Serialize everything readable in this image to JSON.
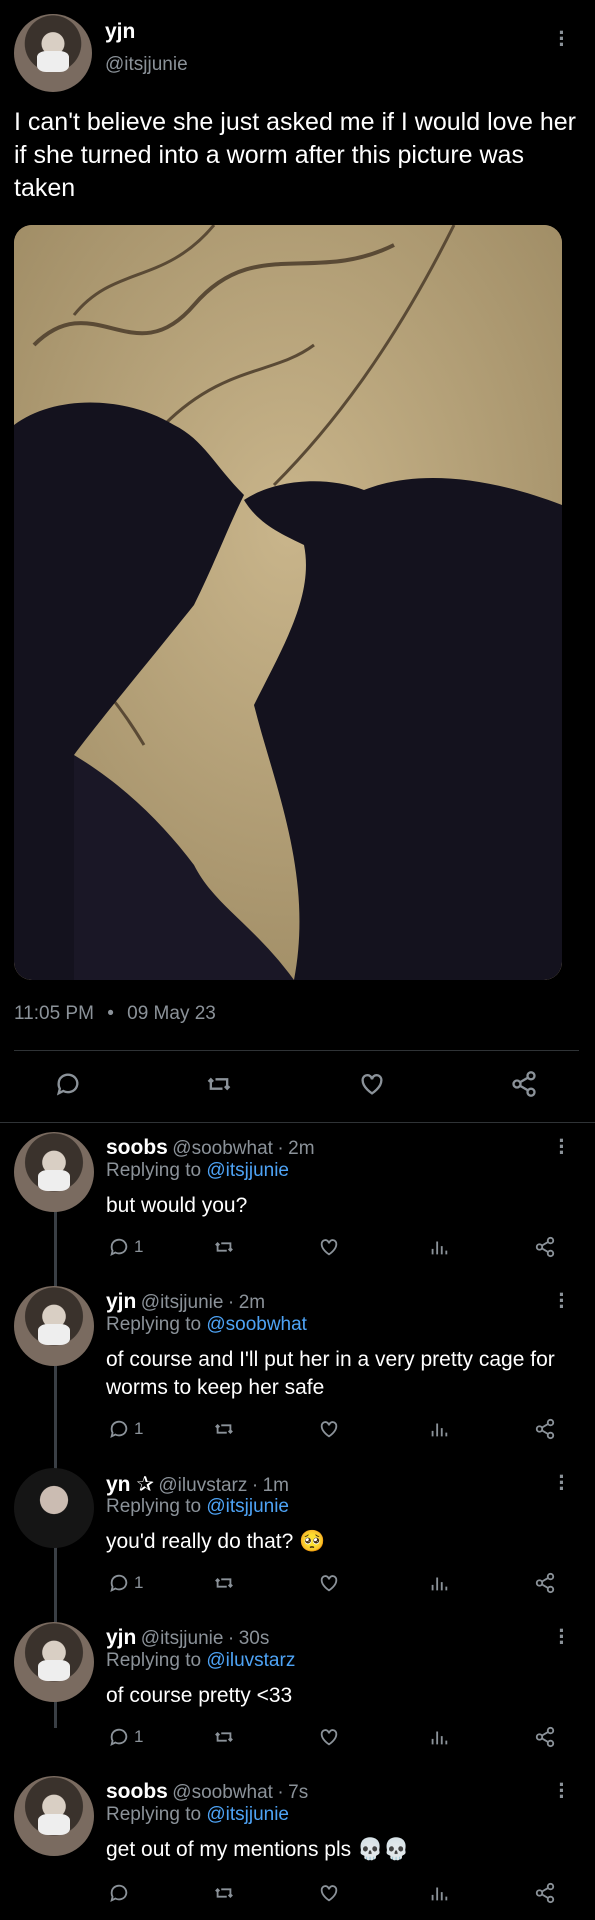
{
  "main_tweet": {
    "name": "yjn",
    "handle": "@itsjjunie",
    "text": "I can't believe she just asked me if I would love her if she turned into a worm after this picture was taken",
    "time": "11:05 PM",
    "date": "09 May 23"
  },
  "replies": [
    {
      "name": "soobs",
      "handle": "@soobwhat",
      "age": "2m",
      "replying_to": "@itsjjunie",
      "text": "but would you?",
      "reply_count": "1"
    },
    {
      "name": "yjn",
      "handle": "@itsjjunie",
      "age": "2m",
      "replying_to": "@soobwhat",
      "text": "of course and I'll put her in a very pretty cage for worms to keep her safe",
      "reply_count": "1"
    },
    {
      "name": "yn ✰",
      "handle": "@iluvstarz",
      "age": "1m",
      "replying_to": "@itsjjunie",
      "text": "you'd really do that? 🥺",
      "reply_count": "1"
    },
    {
      "name": "yjn",
      "handle": "@itsjjunie",
      "age": "30s",
      "replying_to": "@iluvstarz",
      "text": "of course pretty <33",
      "reply_count": "1"
    },
    {
      "name": "soobs",
      "handle": "@soobwhat",
      "age": "7s",
      "replying_to": "@itsjjunie",
      "text": "get out of my mentions pls 💀💀",
      "reply_count": ""
    }
  ],
  "labels": {
    "replying_prefix": "Replying to",
    "dot": "·",
    "bullet": "•"
  },
  "colors": {
    "background": "#000000",
    "link": "#4ea3f5",
    "muted": "#8b9299"
  }
}
